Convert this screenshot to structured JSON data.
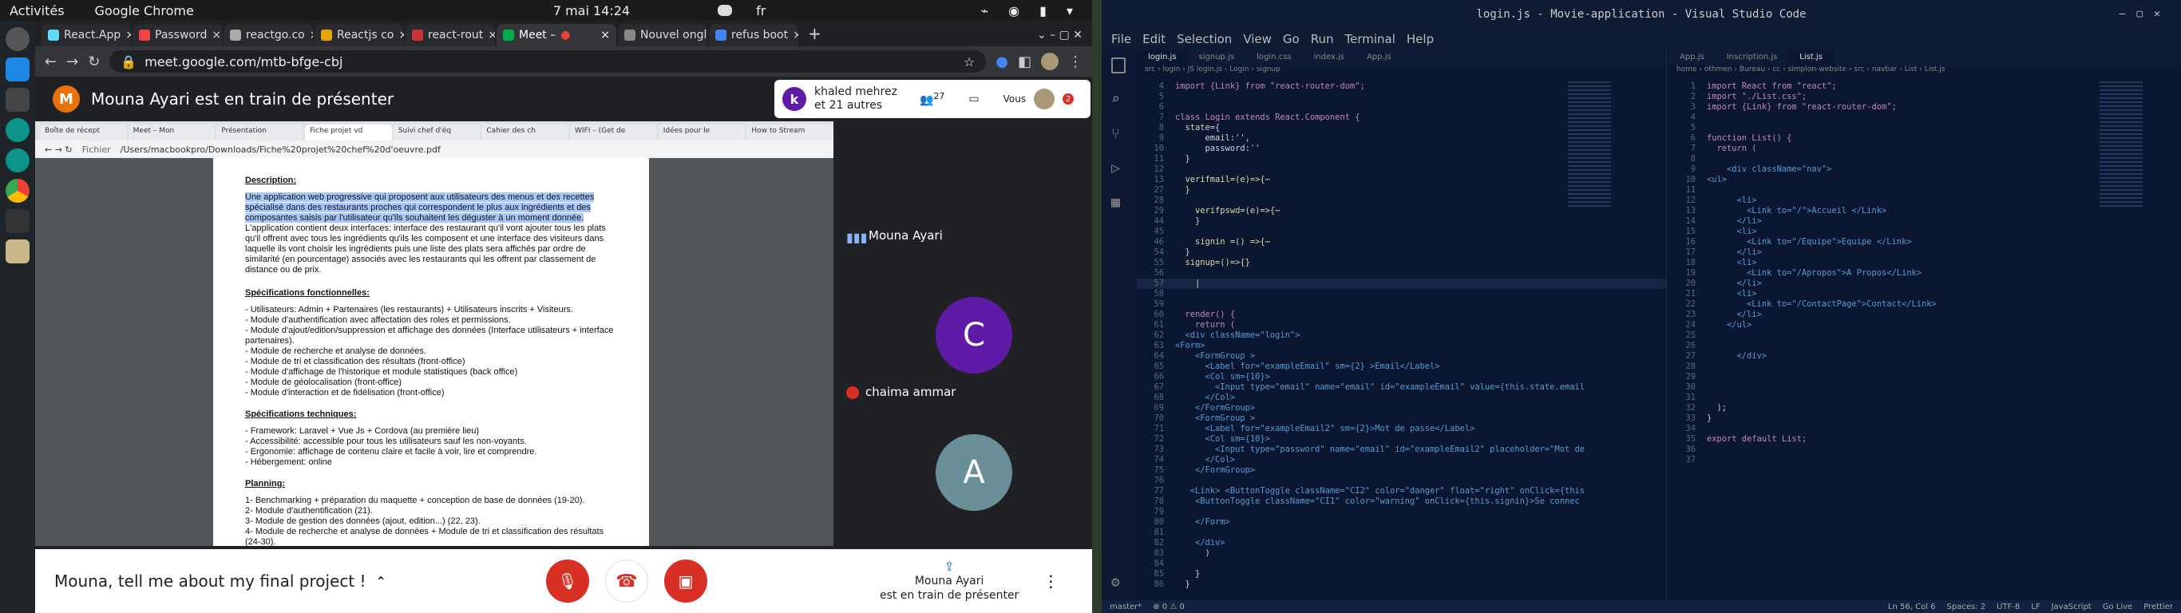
{
  "gnome": {
    "activities": "Activités",
    "app": "Google Chrome",
    "clock": "7 mai  14:24",
    "lang": "fr"
  },
  "chrome": {
    "tabs": [
      {
        "label": "React.App",
        "color": "#61dafb"
      },
      {
        "label": "Password",
        "color": "#e44"
      },
      {
        "label": "reactgo.co",
        "color": "#aaa"
      },
      {
        "label": "Reactjs co",
        "color": "#e5a50a"
      },
      {
        "label": "react-rout",
        "color": "#c33"
      },
      {
        "label": "Meet –",
        "color": "#00ac47"
      },
      {
        "label": "Nouvel onglet",
        "color": "#888"
      },
      {
        "label": "refus boot",
        "color": "#4285f4"
      }
    ],
    "url": "meet.google.com/mtb-bfge-cbj"
  },
  "meet": {
    "presenter_initial": "M",
    "presenter_banner": "Mouna Ayari est en train de présenter",
    "participant_initial": "k",
    "participant_line1": "khaled mehrez",
    "participant_line2": "et 21 autres",
    "people_count": "27",
    "you_label": "Vous",
    "chat_badge": "2",
    "tiles": [
      {
        "name": "Mouna Ayari",
        "initial": "",
        "color": "#3c4043"
      },
      {
        "name": "chaima ammar",
        "initial": "C",
        "color": "#5f1aa8"
      },
      {
        "name": "",
        "initial": "A",
        "color": "#6b8f99"
      }
    ],
    "meeting_title": "Mouna, tell me about my final project !",
    "presenting_line1": "Mouna Ayari",
    "presenting_line2": "est en train de présenter"
  },
  "viewer": {
    "tabs": [
      "Boîte de récept",
      "Meet – Mon",
      "Présentation",
      "Fiche projet vd",
      "Suivi chef d'éq",
      "Cahier des ch",
      "WIFI – (Get de",
      "Idées pour le",
      "How to Stream"
    ],
    "url_prefix": "Fichier",
    "url": "/Users/macbookpro/Downloads/Fiche%20projet%20chef%20d'oeuvre.pdf"
  },
  "pdf": {
    "desc_title": "Description:",
    "desc_highlight": "Une application web progressive qui proposent aux  utilisateurs  des menus et des recettes spécialisé dans des restaurants proches qui correspondent le plus aux ingrédients et des composantes saisis par l'utilisateur qu'ils souhaitent les déguster à un moment donnée.",
    "desc_rest": " L'application contient deux interfaces: interface des restaurant qu'il vont ajouter tous les plats qu'il offrent avec tous les ingrédients qu'ils les composent et une interface des visiteurs dans laquelle ils vont choisir les ingrédients puis une liste des plats sera affichés par ordre de similarité (en pourcentage) associés avec les restaurants qui les offrent par classement de distance ou de prix.",
    "func_title": "Spécifications fonctionnelles:",
    "func_items": [
      "- Utilisateurs: Admin + Partenaires (les restaurants) + Utilisateurs inscrits + Visiteurs.",
      "- Module d'authentification avec affectation des roles et permissions.",
      "- Module d'ajout/edition/suppression et affichage des données (Interface utilisateurs + interface partenaires).",
      "- Module de recherche et analyse de données.",
      "- Module de tri et classification des résultats (front-office)",
      "- Module d'affichage de l'historique et module statistiques (back office)",
      "- Module de géolocalisation (front-office)",
      "- Module d'interaction et de fidélisation (front-office)"
    ],
    "tech_title": "Spécifications techniques:",
    "tech_items": [
      "- Framework: Laravel + Vue Js + Cordova (au première lieu)",
      "- Accessibilité: accessible pour tous les utilisateurs sauf les non-voyants.",
      "- Ergonomie: affichage de contenu claire et facile à voir, lire et comprendre.",
      "- Hébergement: online"
    ],
    "plan_title": "Planning:",
    "plan_items": [
      "1- Benchmarking + préparation du maquette + conception de base de données (19-20).",
      "2- Module d'authentification (21).",
      "3- Module de gestion des données (ajout, edition...) (22, 23).",
      "4- Module de recherche et analyse de données + Module de tri et classification des résultats (24-30)."
    ]
  },
  "vscode": {
    "title": "login.js - Movie-application - Visual Studio Code",
    "menu": [
      "File",
      "Edit",
      "Selection",
      "View",
      "Go",
      "Run",
      "Terminal",
      "Help"
    ],
    "left_tabs": [
      "login.js",
      "signup.js",
      "login.css",
      "index.js",
      "App.js"
    ],
    "left_crumb": "src  ›  login  ›  JS login.js  ›  Login  ›  signup",
    "right_tabs": [
      "App.js",
      "Inscription.js",
      "List.js"
    ],
    "right_crumb": "home  ›  othmen  ›  Bureau  ›  cc  ›  simplon-website  ›  src  ›  navbar  ›  List  ›  List.js",
    "status_left": "master*",
    "status_right": [
      "Ln 56, Col 6",
      "Spaces: 2",
      "UTF-8",
      "LF",
      "JavaScript",
      "Go Live",
      "Prettier"
    ],
    "left_code": [
      {
        "n": "4",
        "t": "import {Link} from \"react-router-dom\";"
      },
      {
        "n": "5",
        "t": ""
      },
      {
        "n": "6",
        "t": ""
      },
      {
        "n": "7",
        "t": "class Login extends React.Component {"
      },
      {
        "n": "8",
        "t": "  state={"
      },
      {
        "n": "9",
        "t": "      email:'',"
      },
      {
        "n": "10",
        "t": "      password:''"
      },
      {
        "n": "11",
        "t": "  }"
      },
      {
        "n": "12",
        "t": ""
      },
      {
        "n": "13",
        "t": "  verifmail=(e)=>{⋯"
      },
      {
        "n": "27",
        "t": "  }"
      },
      {
        "n": "28",
        "t": ""
      },
      {
        "n": "29",
        "t": "    verifpswd=(e)=>{⋯"
      },
      {
        "n": "44",
        "t": "    }"
      },
      {
        "n": "45",
        "t": ""
      },
      {
        "n": "46",
        "t": "    signin =() =>{⋯"
      },
      {
        "n": "54",
        "t": "  }"
      },
      {
        "n": "55",
        "t": "  signup=()=>{}"
      },
      {
        "n": "56",
        "t": ""
      },
      {
        "n": "57",
        "t": "    |"
      },
      {
        "n": "58",
        "t": ""
      },
      {
        "n": "59",
        "t": ""
      },
      {
        "n": "60",
        "t": "  render() {"
      },
      {
        "n": "61",
        "t": "    return ("
      },
      {
        "n": "62",
        "t": "  <div className=\"login\">"
      },
      {
        "n": "63",
        "t": "<Form>"
      },
      {
        "n": "64",
        "t": "    <FormGroup >"
      },
      {
        "n": "65",
        "t": "      <Label for=\"exampleEmail\" sm={2} >Email</Label>"
      },
      {
        "n": "66",
        "t": "      <Col sm={10}>"
      },
      {
        "n": "67",
        "t": "        <Input type=\"email\" name=\"email\" id=\"exampleEmail\" value={this.state.email"
      },
      {
        "n": "68",
        "t": "      </Col>"
      },
      {
        "n": "69",
        "t": "    </FormGroup>"
      },
      {
        "n": "70",
        "t": "    <FormGroup >"
      },
      {
        "n": "71",
        "t": "      <Label for=\"exampleEmail2\" sm={2}>Mot de passe</Label>"
      },
      {
        "n": "72",
        "t": "      <Col sm={10}>"
      },
      {
        "n": "73",
        "t": "        <Input type=\"password\" name=\"email\" id=\"exampleEmail2\" placeholder=\"Mot de"
      },
      {
        "n": "74",
        "t": "      </Col>"
      },
      {
        "n": "75",
        "t": "    </FormGroup>"
      },
      {
        "n": "76",
        "t": ""
      },
      {
        "n": "77",
        "t": "   <Link> <ButtonToggle className=\"CI2\" color=\"danger\" float=\"right\" onClick={this"
      },
      {
        "n": "78",
        "t": "    <ButtonToggle className=\"CI1\" color=\"warning\" onClick={this.signin}>Se connec"
      },
      {
        "n": "79",
        "t": ""
      },
      {
        "n": "80",
        "t": "    </Form>"
      },
      {
        "n": "81",
        "t": ""
      },
      {
        "n": "82",
        "t": "    </div>"
      },
      {
        "n": "83",
        "t": "      )"
      },
      {
        "n": "84",
        "t": ""
      },
      {
        "n": "85",
        "t": "    }"
      },
      {
        "n": "86",
        "t": "  }"
      }
    ],
    "right_code": [
      {
        "n": "1",
        "t": "import React from \"react\";"
      },
      {
        "n": "2",
        "t": "import \"./List.css\";"
      },
      {
        "n": "3",
        "t": "import {Link} from \"react-router-dom\";"
      },
      {
        "n": "4",
        "t": ""
      },
      {
        "n": "5",
        "t": ""
      },
      {
        "n": "6",
        "t": "function List() {"
      },
      {
        "n": "7",
        "t": "  return ("
      },
      {
        "n": "8",
        "t": ""
      },
      {
        "n": "9",
        "t": "    <div className=\"nav\">"
      },
      {
        "n": "10",
        "t": "<ul>"
      },
      {
        "n": "11",
        "t": ""
      },
      {
        "n": "12",
        "t": "      <li>"
      },
      {
        "n": "13",
        "t": "        <Link to=\"/\">Accueil </Link>"
      },
      {
        "n": "14",
        "t": "      </li>"
      },
      {
        "n": "15",
        "t": "      <li>"
      },
      {
        "n": "16",
        "t": "        <Link to=\"/Equipe\">Equipe </Link>"
      },
      {
        "n": "17",
        "t": "      </li>"
      },
      {
        "n": "18",
        "t": "      <li>"
      },
      {
        "n": "19",
        "t": "        <Link to=\"/Apropos\">A Propos</Link>"
      },
      {
        "n": "20",
        "t": "      </li>"
      },
      {
        "n": "21",
        "t": "      <li>"
      },
      {
        "n": "22",
        "t": "        <Link to=\"/ContactPage\">Contact</Link>"
      },
      {
        "n": "23",
        "t": "      </li>"
      },
      {
        "n": "24",
        "t": "    </ul>"
      },
      {
        "n": "25",
        "t": ""
      },
      {
        "n": "26",
        "t": ""
      },
      {
        "n": "27",
        "t": "      </div>"
      },
      {
        "n": "28",
        "t": ""
      },
      {
        "n": "29",
        "t": ""
      },
      {
        "n": "30",
        "t": ""
      },
      {
        "n": "31",
        "t": ""
      },
      {
        "n": "32",
        "t": "  );"
      },
      {
        "n": "33",
        "t": "}"
      },
      {
        "n": "34",
        "t": ""
      },
      {
        "n": "35",
        "t": "export default List;"
      },
      {
        "n": "36",
        "t": ""
      },
      {
        "n": "37",
        "t": ""
      }
    ]
  }
}
